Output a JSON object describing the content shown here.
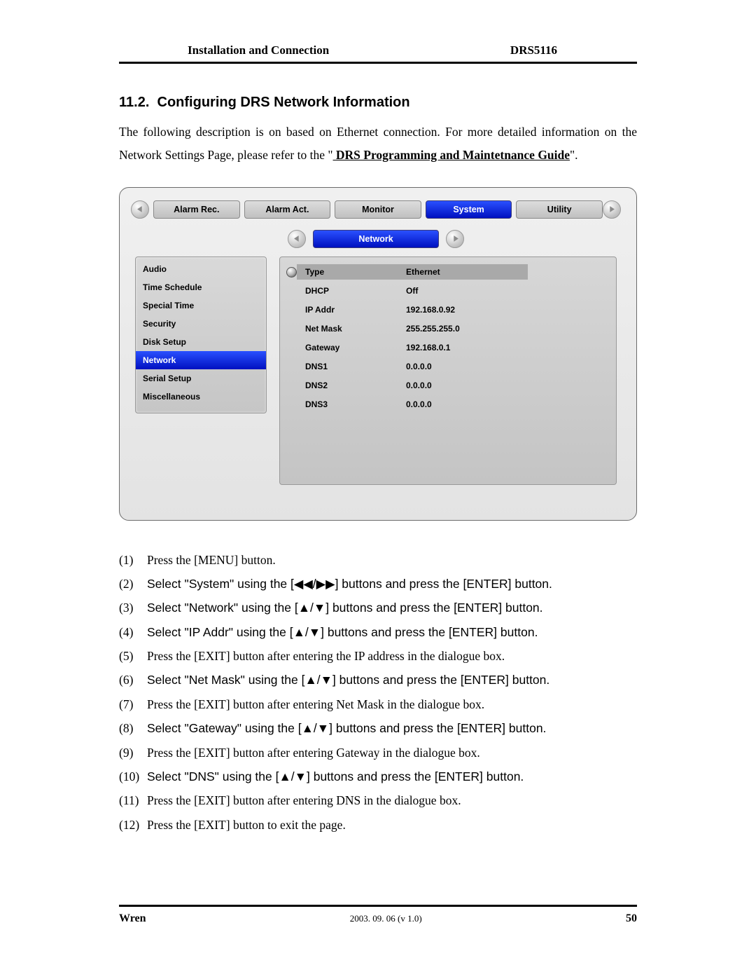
{
  "header": {
    "left": "Installation and Connection",
    "right": "DRS5116"
  },
  "section": {
    "number": "11.2.",
    "title": "Configuring DRS Network Information",
    "intro_a": "The following description is on based on Ethernet connection.   For more detailed information on the Network Settings Page, please refer to the \"",
    "intro_link": " DRS Programming and Maintetnance Guide",
    "intro_b": "\"."
  },
  "screenshot": {
    "tabs": [
      "Alarm Rec.",
      "Alarm Act.",
      "Monitor",
      "System",
      "Utility"
    ],
    "active_tab_index": 3,
    "subtab": "Network",
    "sidebar": [
      "Audio",
      "Time Schedule",
      "Special Time",
      "Security",
      "Disk Setup",
      "Network",
      "Serial Setup",
      "Miscellaneous"
    ],
    "sidebar_active_index": 5,
    "fields": [
      {
        "label": "Type",
        "value": "Ethernet",
        "highlight": true,
        "cursor": true
      },
      {
        "label": "DHCP",
        "value": "Off",
        "highlight": false,
        "cursor": false
      },
      {
        "label": "IP Addr",
        "value": "192.168.0.92",
        "highlight": false,
        "cursor": false
      },
      {
        "label": "Net Mask",
        "value": "255.255.255.0",
        "highlight": false,
        "cursor": false
      },
      {
        "label": "Gateway",
        "value": "192.168.0.1",
        "highlight": false,
        "cursor": false
      },
      {
        "label": "DNS1",
        "value": "0.0.0.0",
        "highlight": false,
        "cursor": false
      },
      {
        "label": "DNS2",
        "value": "0.0.0.0",
        "highlight": false,
        "cursor": false
      },
      {
        "label": "DNS3",
        "value": "0.0.0.0",
        "highlight": false,
        "cursor": false
      }
    ]
  },
  "steps": [
    "Press the [MENU] button.",
    "Select \"System\" using the [◀◀/▶▶] buttons and press the [ENTER] button.",
    "Select \"Network\" using the [▲/▼] buttons and press the [ENTER] button.",
    "Select \"IP Addr\" using the [▲/▼] buttons and press the [ENTER] button.",
    "Press the [EXIT] button after entering the IP address in the dialogue box.",
    "Select \"Net Mask\" using the [▲/▼] buttons and press the [ENTER] button.",
    "Press the [EXIT] button after entering Net Mask in the dialogue box.",
    "Select \"Gateway\" using the [▲/▼] buttons and press the [ENTER] button.",
    "Press the [EXIT] button after entering Gateway in the dialogue box.",
    "Select \"DNS\" using the [▲/▼] buttons and press the [ENTER] button.",
    "Press the [EXIT] button after entering DNS in the dialogue box.",
    "Press the [EXIT] button to exit the page."
  ],
  "footer": {
    "left": "Wren",
    "date": "2003. 09. 06 (v 1.0)",
    "page": "50"
  }
}
